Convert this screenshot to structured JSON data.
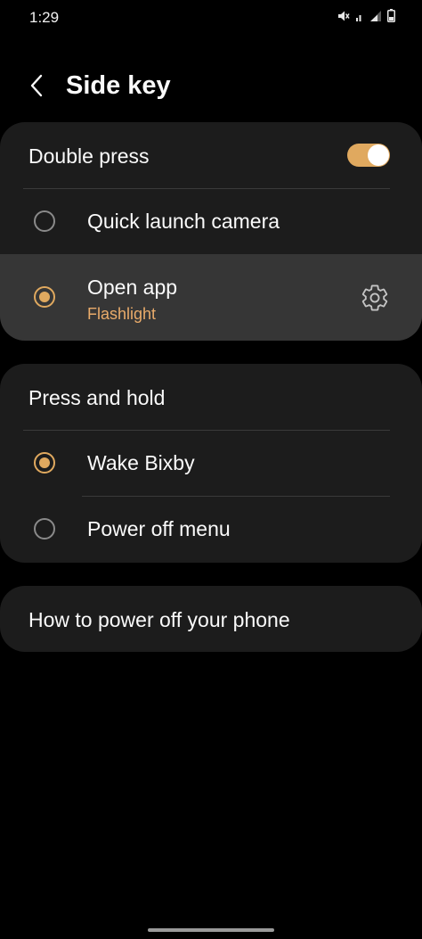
{
  "status_bar": {
    "time": "1:29",
    "icons": [
      "mute-icon",
      "wifi-icon",
      "signal-icon",
      "battery-icon"
    ]
  },
  "app_bar": {
    "back_icon": "chevron-left-icon",
    "title": "Side key"
  },
  "double_press": {
    "header": "Double press",
    "toggle_on": true,
    "options": [
      {
        "label": "Quick launch camera",
        "selected": false
      },
      {
        "label": "Open app",
        "sublabel": "Flashlight",
        "selected": true,
        "settings_icon": "gear-icon"
      }
    ]
  },
  "press_and_hold": {
    "header": "Press and hold",
    "options": [
      {
        "label": "Wake Bixby",
        "selected": true
      },
      {
        "label": "Power off menu",
        "selected": false
      }
    ]
  },
  "help": {
    "label": "How to power off your phone"
  },
  "colors": {
    "accent": "#e0a95f",
    "sublabel": "#e9ab6a",
    "card": "#1c1c1c",
    "selected_row": "#363636",
    "background": "#000000"
  }
}
